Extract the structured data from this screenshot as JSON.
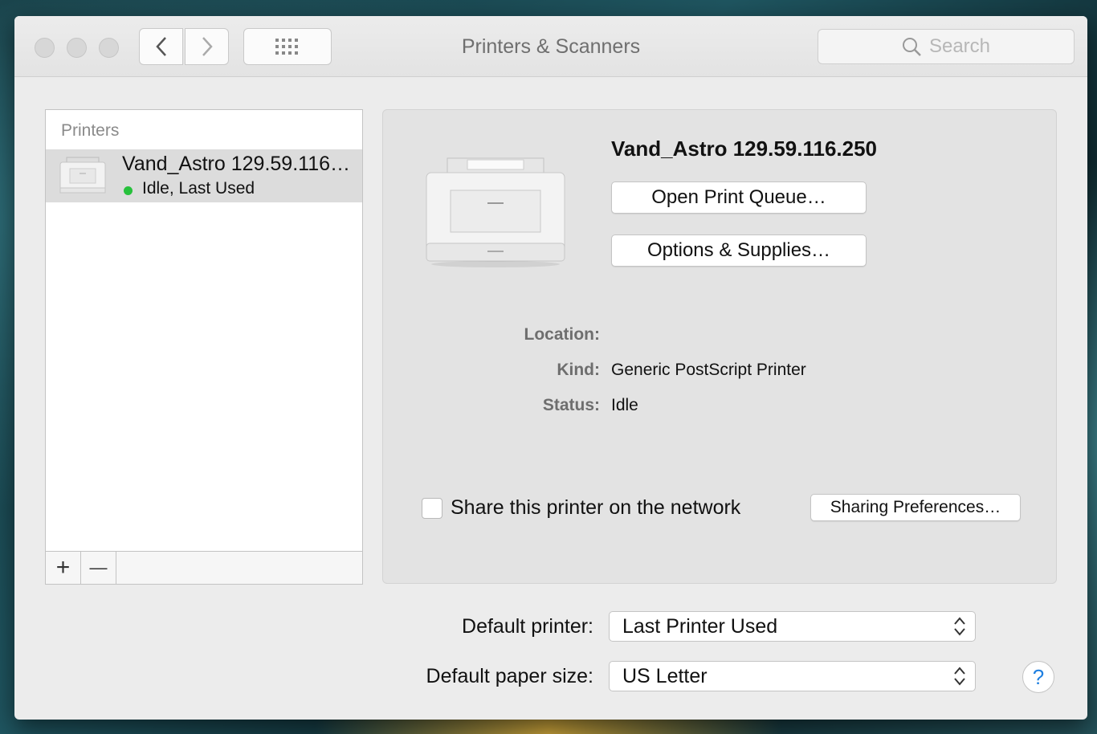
{
  "window": {
    "title": "Printers & Scanners"
  },
  "search": {
    "placeholder": "Search"
  },
  "printers_list": {
    "header": "Printers",
    "items": [
      {
        "name": "Vand_Astro 129.59.116…",
        "status": "Idle, Last Used",
        "status_color": "#27c13c"
      }
    ],
    "add_symbol": "+",
    "remove_symbol": "—"
  },
  "detail": {
    "printer_name": "Vand_Astro 129.59.116.250",
    "open_queue_label": "Open Print Queue…",
    "options_label": "Options & Supplies…",
    "location_label": "Location:",
    "location_value": "",
    "kind_label": "Kind:",
    "kind_value": "Generic PostScript Printer",
    "status_label": "Status:",
    "status_value": "Idle",
    "share_label": "Share this printer on the network",
    "share_checked": false,
    "sharing_prefs_label": "Sharing Preferences…"
  },
  "defaults": {
    "default_printer_label": "Default printer:",
    "default_printer_value": "Last Printer Used",
    "paper_size_label": "Default paper size:",
    "paper_size_value": "US Letter"
  },
  "help_label": "?",
  "colors": {
    "accent": "#1e7fe0",
    "status_green": "#27c13c"
  }
}
